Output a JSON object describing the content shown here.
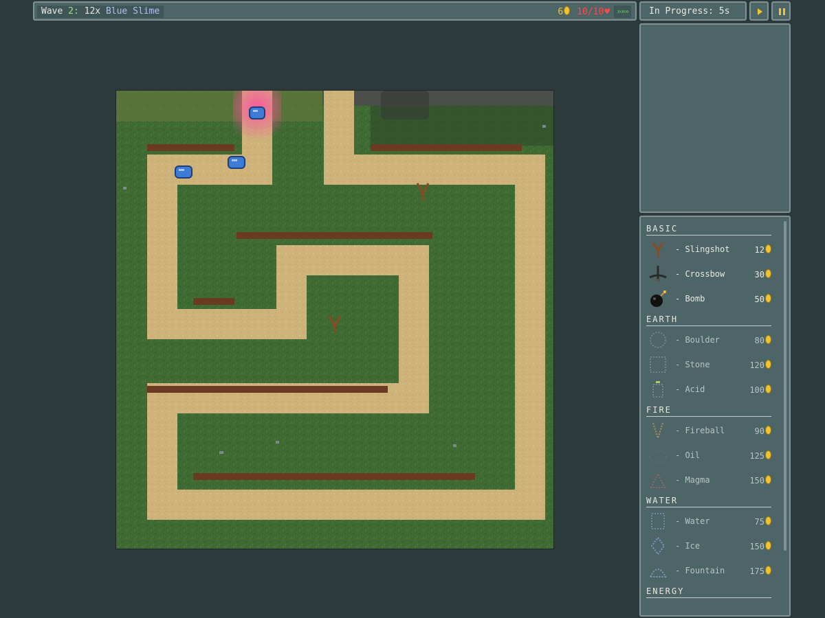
{
  "topbar": {
    "wave_label": "Wave",
    "wave_number": "2:",
    "wave_count": "12x",
    "wave_enemy": "Blue Slime",
    "gold": "6",
    "lives": "10/10",
    "speed_indicator": "»»»"
  },
  "status": {
    "text": "In Progress: 5s"
  },
  "controls": {
    "play_icon": "play-icon",
    "pause_icon": "pause-icon"
  },
  "shop": {
    "categories": [
      {
        "name": "BASIC",
        "towers": [
          {
            "name": "Slingshot",
            "cost": "12",
            "icon": "slingshot-icon"
          },
          {
            "name": "Crossbow",
            "cost": "30",
            "icon": "crossbow-icon"
          },
          {
            "name": "Bomb",
            "cost": "50",
            "icon": "bomb-icon"
          }
        ]
      },
      {
        "name": "EARTH",
        "towers": [
          {
            "name": "Boulder",
            "cost": "80",
            "icon": "boulder-icon"
          },
          {
            "name": "Stone",
            "cost": "120",
            "icon": "stone-icon"
          },
          {
            "name": "Acid",
            "cost": "100",
            "icon": "acid-icon"
          }
        ]
      },
      {
        "name": "FIRE",
        "towers": [
          {
            "name": "Fireball",
            "cost": "90",
            "icon": "fireball-icon"
          },
          {
            "name": "Oil",
            "cost": "125",
            "icon": "oil-icon"
          },
          {
            "name": "Magma",
            "cost": "150",
            "icon": "magma-icon"
          }
        ]
      },
      {
        "name": "WATER",
        "towers": [
          {
            "name": "Water",
            "cost": "75",
            "icon": "water-icon"
          },
          {
            "name": "Ice",
            "cost": "150",
            "icon": "ice-icon"
          },
          {
            "name": "Fountain",
            "cost": "175",
            "icon": "fountain-icon"
          }
        ]
      },
      {
        "name": "ENERGY",
        "towers": []
      }
    ]
  },
  "colors": {
    "background": "#2c3a3c",
    "panel": "#4e6568",
    "gold": "#f1c232",
    "lives": "#ff4848",
    "grass": "#3f6a34",
    "path": "#cdb27a",
    "slime": "#3d7bd4"
  }
}
